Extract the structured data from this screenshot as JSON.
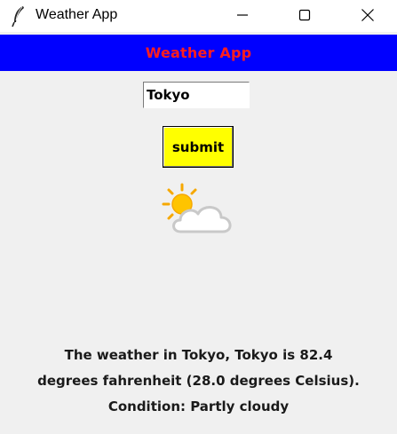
{
  "window": {
    "title": "Weather App",
    "icon": "feather-icon"
  },
  "banner": {
    "text": "Weather App",
    "bg_color": "#0000ff",
    "text_color": "#ff1e1e"
  },
  "form": {
    "city_value": "Tokyo",
    "submit_label": "submit",
    "submit_color": "#ffff00"
  },
  "weather": {
    "icon": "partly-cloudy-icon",
    "lines": [
      "The weather in Tokyo, Tokyo is 82.4",
      "degrees fahrenheit (28.0 degrees Celsius).",
      "Condition: Partly cloudy"
    ]
  }
}
